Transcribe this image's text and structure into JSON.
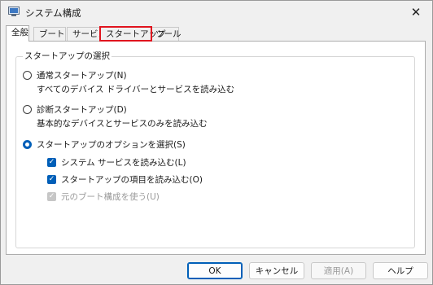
{
  "window": {
    "title": "システム構成"
  },
  "tabs": [
    {
      "label": "全般",
      "selected": true
    },
    {
      "label": "ブート"
    },
    {
      "label": "サービス"
    },
    {
      "label": "スタートアップ",
      "highlighted": true
    },
    {
      "label": "ツール"
    }
  ],
  "startup_selection": {
    "title": "スタートアップの選択",
    "normal": {
      "label": "通常スタートアップ(N)",
      "description": "すべてのデバイス ドライバーとサービスを読み込む",
      "selected": false
    },
    "diagnostic": {
      "label": "診断スタートアップ(D)",
      "description": "基本的なデバイスとサービスのみを読み込む",
      "selected": false
    },
    "selective": {
      "label": "スタートアップのオプションを選択(S)",
      "selected": true,
      "load_system_services": {
        "label": "システム サービスを読み込む(L)",
        "checked": true
      },
      "load_startup_items": {
        "label": "スタートアップの項目を読み込む(O)",
        "checked": true
      },
      "use_original_boot": {
        "label": "元のブート構成を使う(U)",
        "checked": true,
        "disabled": true
      }
    }
  },
  "buttons": {
    "ok": "OK",
    "cancel": "キャンセル",
    "apply": "適用(A)",
    "help": "ヘルプ"
  },
  "colors": {
    "accent": "#005fb8",
    "highlight": "#e0141e"
  }
}
